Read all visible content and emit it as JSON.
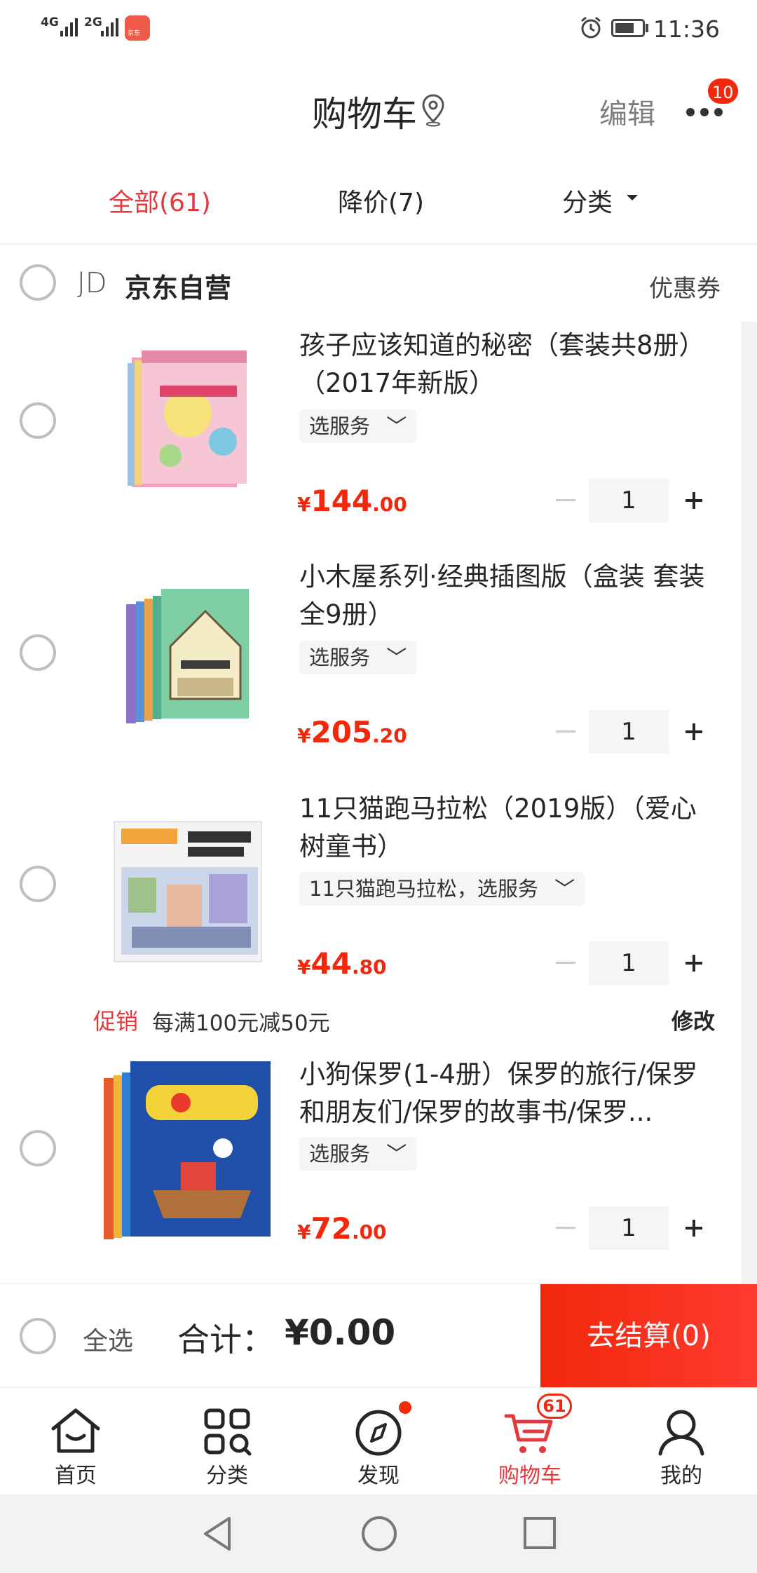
{
  "status_bar": {
    "signal1_label": "4G",
    "signal2_label": "2G",
    "app_badge_text": "京东",
    "time": "11:36"
  },
  "header": {
    "title": "购物车",
    "edit_label": "编辑",
    "more_badge": "10"
  },
  "tabs": [
    {
      "label": "全部(61)",
      "active": true
    },
    {
      "label": "降价(7)",
      "active": false
    },
    {
      "label": "分类",
      "active": false
    }
  ],
  "shop": {
    "logo_text": "JD",
    "name": "京东自营",
    "coupon_label": "优惠券"
  },
  "products": [
    {
      "title": "孩子应该知道的秘密（套装共8册）（2017年新版）",
      "service": "选服务",
      "currency": "¥",
      "price_int": "144",
      "price_dec": ".00",
      "quantity": "1"
    },
    {
      "title": "小木屋系列·经典插图版（盒装 套装全9册）",
      "service": "选服务",
      "currency": "¥",
      "price_int": "205",
      "price_dec": ".20",
      "quantity": "1"
    },
    {
      "title": "11只猫跑马拉松（2019版）（爱心树童书）",
      "service": "11只猫跑马拉松，选服务",
      "currency": "¥",
      "price_int": "44",
      "price_dec": ".80",
      "quantity": "1"
    },
    {
      "title": "小狗保罗(1-4册）保罗的旅行/保罗和朋友们/保罗的故事书/保罗...",
      "service": "选服务",
      "currency": "¥",
      "price_int": "72",
      "price_dec": ".00",
      "quantity": "1"
    }
  ],
  "promo": {
    "tag": "促销",
    "text": "每满100元减50元",
    "edit_label": "修改"
  },
  "checkout": {
    "select_all_label": "全选",
    "total_label": "合计：",
    "total_value": "¥0.00",
    "button_label": "去结算(0)"
  },
  "bottom_nav": [
    {
      "label": "首页",
      "icon": "home-icon",
      "active": false
    },
    {
      "label": "分类",
      "icon": "category-icon",
      "active": false
    },
    {
      "label": "发现",
      "icon": "discover-icon",
      "active": false
    },
    {
      "label": "购物车",
      "icon": "cart-icon",
      "active": true,
      "badge": "61"
    },
    {
      "label": "我的",
      "icon": "profile-icon",
      "active": false
    }
  ],
  "colors": {
    "accent": "#e4393c",
    "price": "#f2270c",
    "checkout_button": "#f2270c"
  }
}
